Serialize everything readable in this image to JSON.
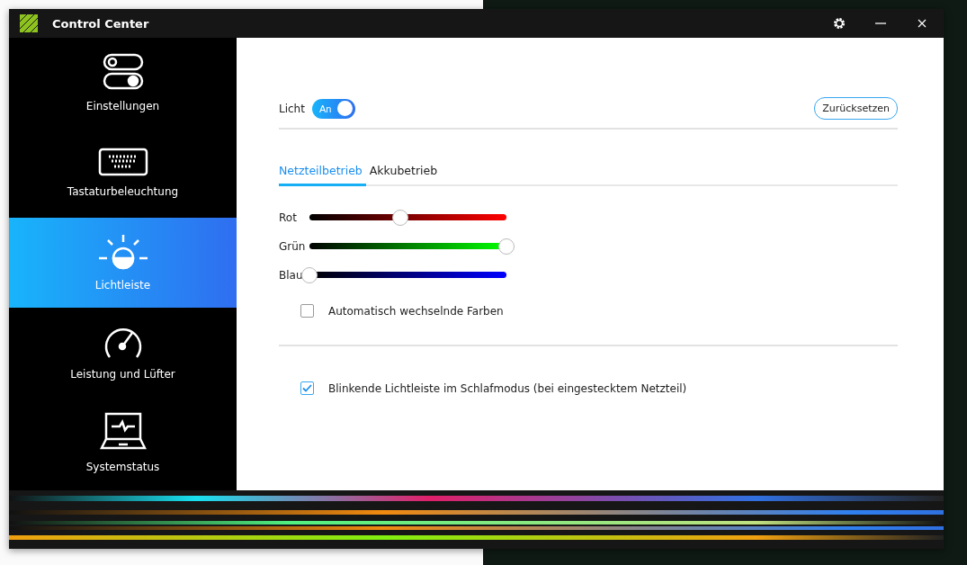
{
  "window": {
    "title": "Control Center"
  },
  "sidebar": {
    "items": [
      {
        "label": "Einstellungen",
        "kind": "toggles",
        "selected": false
      },
      {
        "label": "Tastaturbeleuchtung",
        "kind": "keyboard",
        "selected": false
      },
      {
        "label": "Lichtleiste",
        "kind": "light",
        "selected": true
      },
      {
        "label": "Leistung und Lüfter",
        "kind": "gauge",
        "selected": false
      },
      {
        "label": "Systemstatus",
        "kind": "laptop",
        "selected": false
      }
    ]
  },
  "light": {
    "label": "Licht",
    "toggle": {
      "label": "An",
      "on": true
    },
    "reset_button": "Zurücksetzen"
  },
  "tabs": [
    {
      "label": "Netzteilbetrieb",
      "selected": true
    },
    {
      "label": "Akkubetrieb",
      "selected": false
    }
  ],
  "sliders": [
    {
      "label": "Rot",
      "kind": "red",
      "level": 0.46
    },
    {
      "label": "Grün",
      "kind": "green",
      "level": 1
    },
    {
      "label": "Blau",
      "kind": "blue",
      "level": 0
    }
  ],
  "auto_colors": {
    "label": "Automatisch wechselnde Farben",
    "checked": false
  },
  "sleep_blink": {
    "label": "Blinkende Lichtleiste im Schlafmodus (bei eingestecktem Netzteil)",
    "checked": true
  }
}
